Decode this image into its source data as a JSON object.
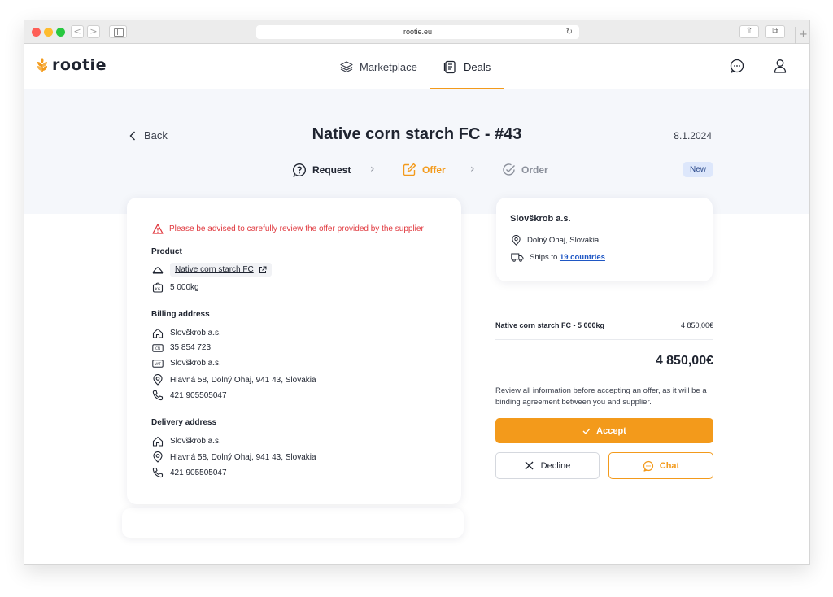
{
  "browser": {
    "url": "rootie.eu",
    "nav_back": "<",
    "nav_forward": ">",
    "reload_glyph": "↻",
    "share_glyph": "⇧",
    "tabs_glyph": "⧉",
    "new_tab_glyph": "+"
  },
  "header": {
    "logo_text": "rootie",
    "nav": [
      {
        "label": "Marketplace",
        "icon": "layers-icon",
        "active": false
      },
      {
        "label": "Deals",
        "icon": "document-icon",
        "active": true
      }
    ],
    "chat_icon": "chat-bubble-icon",
    "user_icon": "user-icon"
  },
  "page": {
    "back_label": "Back",
    "title": "Native corn starch FC - #43",
    "date": "8.1.2024",
    "status_badge": "New",
    "steps": [
      {
        "label": "Request",
        "state": "done",
        "icon": "question-bubble-icon"
      },
      {
        "label": "Offer",
        "state": "current",
        "icon": "edit-icon"
      },
      {
        "label": "Order",
        "state": "pending",
        "icon": "check-circle-icon"
      }
    ]
  },
  "offer_card": {
    "warning": "Please be advised to carefully review the offer provided by the supplier",
    "product_title": "Product",
    "product_name": "Native corn starch FC",
    "product_qty": "5 000kg",
    "billing_title": "Billing address",
    "billing": {
      "company": "Slovškrob a.s.",
      "cin": "35 854 723",
      "vat": "Slovškrob a.s.",
      "address": "Hlavná 58, Dolný Ohaj, 941 43, Slovakia",
      "phone": "421 905505047"
    },
    "delivery_title": "Delivery address",
    "delivery": {
      "company": "Slovškrob a.s.",
      "address": "Hlavná 58, Dolný Ohaj, 941 43, Slovakia",
      "phone": "421 905505047"
    }
  },
  "supplier": {
    "name": "Slovškrob a.s.",
    "location": "Dolný Ohaj, Slovakia",
    "ships_prefix": "Ships to ",
    "ships_link": "19 countries"
  },
  "summary": {
    "line_label": "Native corn starch FC - 5 000kg",
    "line_price": "4 850,00€",
    "total": "4 850,00€",
    "note": "Review all information before accepting an offer, as it will be a binding agreement between you and supplier.",
    "accept_label": "Accept",
    "decline_label": "Decline",
    "chat_label": "Chat"
  },
  "colors": {
    "accent": "#f39a1b",
    "warning": "#e0383e",
    "link": "#1f57c4",
    "badge_bg": "#dde7fb"
  }
}
